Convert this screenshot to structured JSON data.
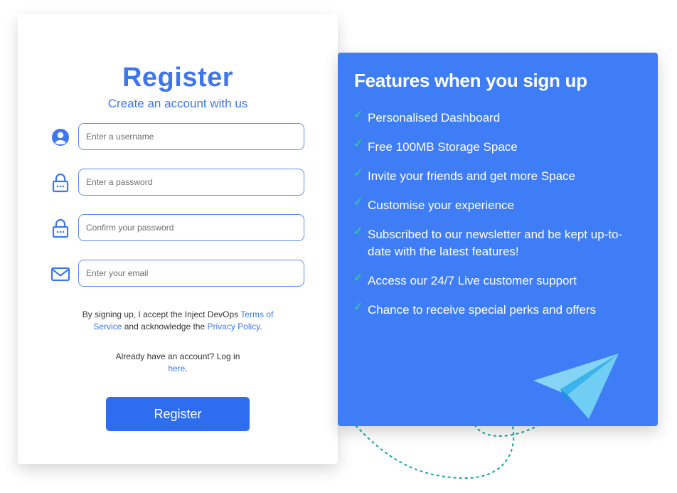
{
  "register_card": {
    "title": "Register",
    "subtitle": "Create an account with us",
    "fields": [
      {
        "icon": "user-icon",
        "placeholder": "Enter a username"
      },
      {
        "icon": "lock-icon",
        "placeholder": "Enter a password"
      },
      {
        "icon": "lock-icon",
        "placeholder": "Confirm your password"
      },
      {
        "icon": "mail-icon",
        "placeholder": "Enter your email"
      }
    ],
    "terms": {
      "prefix": "By signing up, I accept the Inject DevOps ",
      "terms_link": "Terms of Service",
      "middle": " and acknowledge the ",
      "privacy_link": "Privacy Policy",
      "suffix": "."
    },
    "login": {
      "prefix": "Already have an account? Log in ",
      "link": "here",
      "suffix": "."
    },
    "button_label": "Register"
  },
  "features_panel": {
    "title": "Features when you sign up",
    "check_glyph": "✓",
    "items": [
      "Personalised Dashboard",
      "Free 100MB Storage Space",
      "Invite your friends and get more Space",
      "Customise your experience",
      "Subscribed to our newsletter and be kept up-to-date with the latest features!",
      "Access our 24/7 Live customer support",
      "Chance to receive special perks and offers"
    ],
    "decoration_icon": "paper-plane-icon"
  },
  "colors": {
    "accent": "#3f76ec",
    "button": "#2f6df0",
    "panel": "#3f7df6",
    "check": "#2ee07a",
    "dashed_trail": "#13a89e"
  }
}
